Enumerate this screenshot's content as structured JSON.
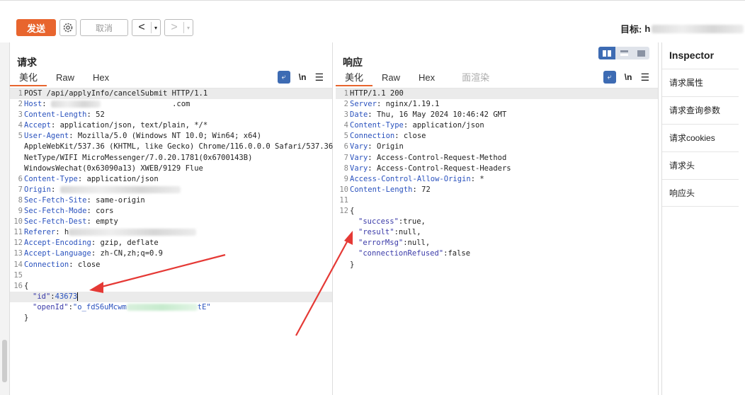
{
  "toolbar": {
    "send_label": "发送",
    "cancel_label": "取消",
    "back_label": "<",
    "forward_label": ">",
    "dropdown_glyph": "▾",
    "target_label": "目标:",
    "target_visible_start": "h"
  },
  "request": {
    "title": "请求",
    "tabs": [
      "美化",
      "Raw",
      "Hex"
    ],
    "active_tab": "美化",
    "actions": {
      "wrap": "⤶",
      "newline": "\\n",
      "menu": "☰"
    },
    "lines": [
      {
        "n": "1",
        "text": "POST /api/applyInfo/cancelSubmit HTTP/1.1"
      },
      {
        "n": "2",
        "key": "Host",
        "val": "                .com"
      },
      {
        "n": "3",
        "key": "Content-Length",
        "val": "52"
      },
      {
        "n": "4",
        "key": "Accept",
        "val": "application/json, text/plain, */*"
      },
      {
        "n": "5",
        "key": "User-Agent",
        "val": "Mozilla/5.0 (Windows NT 10.0; Win64; x64)"
      },
      {
        "n": "",
        "text": "AppleWebKit/537.36 (KHTML, like Gecko) Chrome/116.0.0.0 Safari/537.36"
      },
      {
        "n": "",
        "text": "NetType/WIFI MicroMessenger/7.0.20.1781(0x6700143B)"
      },
      {
        "n": "",
        "text": "WindowsWechat(0x63090a13) XWEB/9129 Flue"
      },
      {
        "n": "6",
        "key": "Content-Type",
        "val": "application/json"
      },
      {
        "n": "7",
        "key": "Origin",
        "val": ""
      },
      {
        "n": "8",
        "key": "Sec-Fetch-Site",
        "val": "same-origin"
      },
      {
        "n": "9",
        "key": "Sec-Fetch-Mode",
        "val": "cors"
      },
      {
        "n": "10",
        "key": "Sec-Fetch-Dest",
        "val": "empty"
      },
      {
        "n": "11",
        "key": "Referer",
        "val": "h"
      },
      {
        "n": "12",
        "key": "Accept-Encoding",
        "val": "gzip, deflate"
      },
      {
        "n": "13",
        "key": "Accept-Language",
        "val": "zh-CN,zh;q=0.9"
      },
      {
        "n": "14",
        "key": "Connection",
        "val": "close"
      },
      {
        "n": "15",
        "text": ""
      },
      {
        "n": "16",
        "text": "{"
      }
    ],
    "body": {
      "id_key": "\"id\"",
      "id_val": "43673",
      "openid_key": "\"openId\"",
      "openid_start": "\"o_fdS6uMcwm",
      "openid_end": "tE\"",
      "close": "}"
    }
  },
  "response": {
    "title": "响应",
    "tabs": [
      "美化",
      "Raw",
      "Hex",
      "面渲染"
    ],
    "active_tab": "美化",
    "actions": {
      "wrap": "⤶",
      "newline": "\\n",
      "menu": "☰"
    },
    "lines": [
      {
        "n": "1",
        "text": "HTTP/1.1 200"
      },
      {
        "n": "2",
        "key": "Server",
        "val": "nginx/1.19.1"
      },
      {
        "n": "3",
        "key": "Date",
        "val": "Thu, 16 May 2024 10:46:42 GMT"
      },
      {
        "n": "4",
        "key": "Content-Type",
        "val": "application/json"
      },
      {
        "n": "5",
        "key": "Connection",
        "val": "close"
      },
      {
        "n": "6",
        "key": "Vary",
        "val": "Origin"
      },
      {
        "n": "7",
        "key": "Vary",
        "val": "Access-Control-Request-Method"
      },
      {
        "n": "8",
        "key": "Vary",
        "val": "Access-Control-Request-Headers"
      },
      {
        "n": "9",
        "key": "Access-Control-Allow-Origin",
        "val": "*"
      },
      {
        "n": "10",
        "key": "Content-Length",
        "val": "72"
      },
      {
        "n": "11",
        "text": ""
      },
      {
        "n": "12",
        "text": "{"
      }
    ],
    "body": [
      {
        "k": "\"success\"",
        "v": "true,"
      },
      {
        "k": "\"result\"",
        "v": "null,"
      },
      {
        "k": "\"errorMsg\"",
        "v": "null,"
      },
      {
        "k": "\"connectionRefused\"",
        "v": "false"
      }
    ],
    "close": "}"
  },
  "inspector": {
    "title": "Inspector",
    "items": [
      "请求属性",
      "请求查询参数",
      "请求cookies",
      "请求头",
      "响应头"
    ]
  },
  "colors": {
    "accent": "#e8652e",
    "key_blue": "#2a52be",
    "arrow_red": "#e53935",
    "action_blue": "#3d6bb3"
  }
}
